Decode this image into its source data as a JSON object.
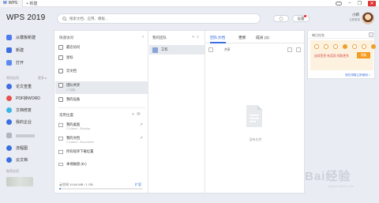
{
  "topbar": {
    "app_tab": "WPS",
    "new_tab": "+ 新建",
    "window_controls": [
      "minimize-icon",
      "restore-icon",
      "close-icon"
    ]
  },
  "header": {
    "brand": "WPS 2019",
    "search_placeholder": "搜索文档、应用、模板...",
    "btn_a": "◯",
    "btn_b": "设置",
    "user_name": "小新",
    "user_sub": "立即登录"
  },
  "sidebar": {
    "items": [
      {
        "label": "从模板新建",
        "color": "#4b7bec"
      },
      {
        "label": "新建",
        "color": "#3b6fe0"
      },
      {
        "label": "打开",
        "color": "#5a8bf0"
      }
    ],
    "section_label": "常用应用",
    "section_more": "更多 ▸",
    "apps": [
      {
        "label": "论文查重",
        "color": "#3b6fe0"
      },
      {
        "label": "PDF转WORD",
        "color": "#e55050"
      },
      {
        "label": "文档修复",
        "color": "#3bb6e0"
      },
      {
        "label": "我的企业",
        "color": "#3b6fe0"
      },
      {
        "label": "",
        "color": "#b0b6c0"
      },
      {
        "label": "流程图",
        "color": "#3b6fe0"
      },
      {
        "label": "云文档",
        "color": "#3b6fe0"
      }
    ],
    "bottom_label": "推荐应用"
  },
  "quick_access": {
    "title": "快速访问",
    "items": [
      {
        "label": "最近访问",
        "sub": ""
      },
      {
        "label": "星标",
        "sub": ""
      },
      {
        "label": "云文档",
        "sub": ""
      },
      {
        "label": "团队共享",
        "sub": "1个团队"
      },
      {
        "label": "我的设备",
        "sub": ""
      }
    ],
    "common_title": "常用位置",
    "locations": [
      {
        "label": "我的桌面",
        "sub": "C:\\Users\\...\\Desktop"
      },
      {
        "label": "我的文档",
        "sub": "C:\\Users\\...\\Documents"
      },
      {
        "label": "所有程序下载位置",
        "sub": ""
      },
      {
        "label": "本地磁盘 (D:)",
        "sub": ""
      }
    ],
    "storage_label": "云空间  19.64 MB / 1 GB",
    "storage_link": "扩容",
    "storage_fraction": 0.02
  },
  "teams": {
    "title": "我的团队",
    "items": [
      {
        "label": "工作"
      }
    ]
  },
  "content": {
    "tabs": [
      "团队文档",
      "更新",
      "成员 (2)"
    ],
    "toolbar_text": "共享",
    "empty_text": "没有文件"
  },
  "widget": {
    "title": "每日任务",
    "message": "连续签到 有奖励 领取更多",
    "button": "领取",
    "link": "现在领取立即使用 >",
    "dots_on": [
      3,
      6
    ]
  },
  "watermark": {
    "text": "Bai经验",
    "sub": "jingyan.baidu.com"
  }
}
